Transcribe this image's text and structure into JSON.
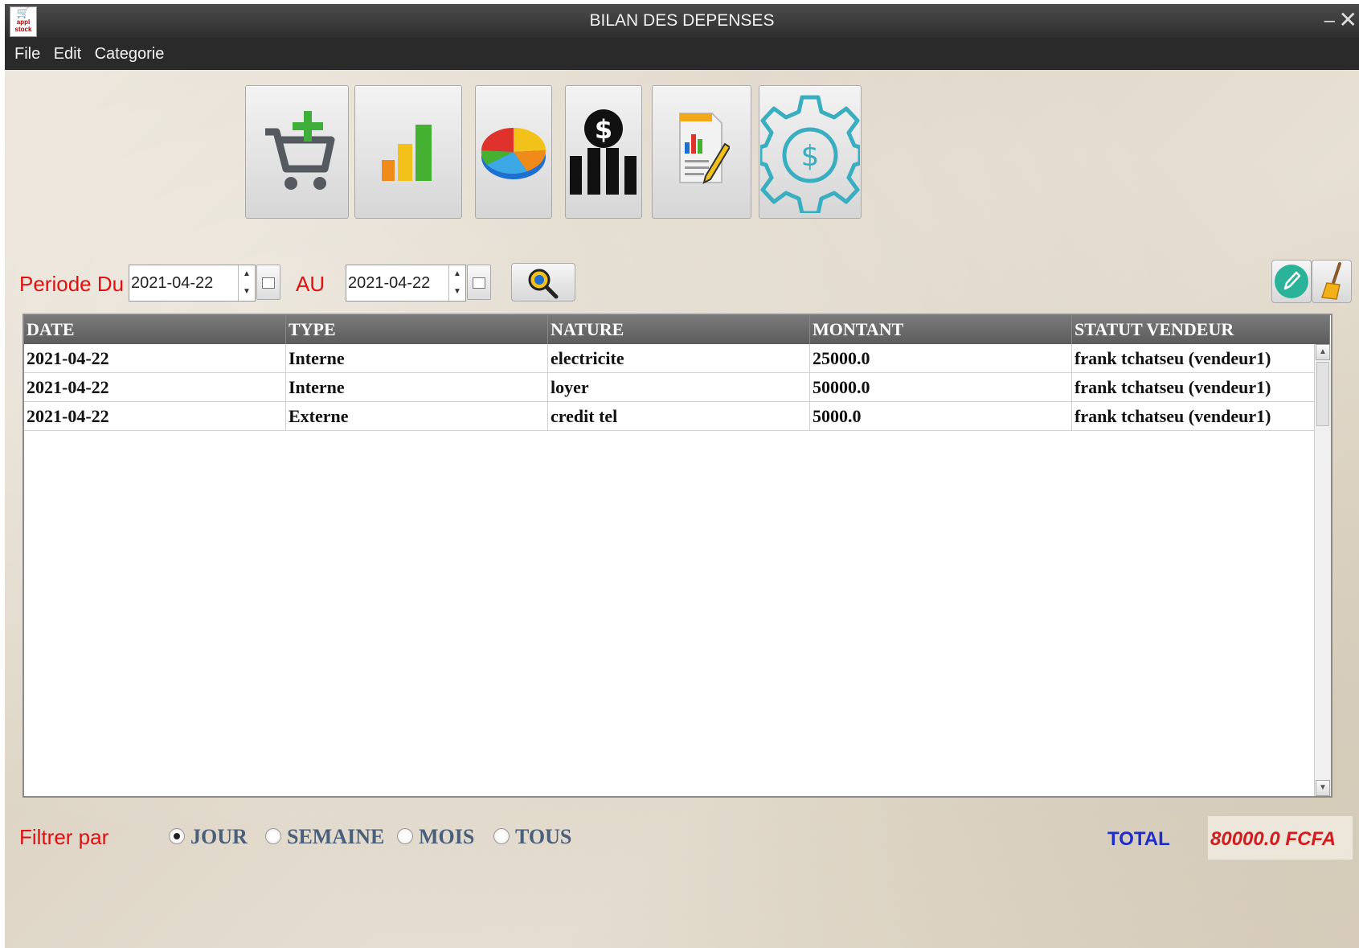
{
  "window": {
    "title": "BILAN DES DEPENSES",
    "logo_text": "appl stock",
    "minimize": "–",
    "close": "✕"
  },
  "menu": [
    "File",
    "Edit",
    "Categorie"
  ],
  "toolbar": {
    "icons": [
      "add-to-cart-icon",
      "bar-chart-icon",
      "pie-chart-icon",
      "dollar-stats-icon",
      "report-edit-icon",
      "dollar-gear-icon"
    ]
  },
  "period": {
    "from_label": "Periode Du",
    "from_value": "2021-04-22",
    "to_label": "AU",
    "to_value": "2021-04-22"
  },
  "table": {
    "headers": [
      "DATE",
      "TYPE",
      "NATURE",
      "MONTANT",
      "STATUT VENDEUR"
    ],
    "rows": [
      [
        "2021-04-22",
        "Interne",
        "electricite",
        "25000.0",
        "frank tchatseu (vendeur1)"
      ],
      [
        "2021-04-22",
        "Interne",
        "loyer",
        "50000.0",
        "frank tchatseu (vendeur1)"
      ],
      [
        "2021-04-22",
        "Externe",
        "credit tel",
        "5000.0",
        "frank tchatseu (vendeur1)"
      ]
    ]
  },
  "filter": {
    "label": "Filtrer par",
    "options": [
      "JOUR",
      "SEMAINE",
      "MOIS",
      "TOUS"
    ],
    "selected": "JOUR"
  },
  "total": {
    "label": "TOTAL",
    "value": "80000.0 FCFA"
  },
  "colors": {
    "label_red": "#e01010",
    "total_blue": "#1e2cc8",
    "total_value_red": "#d31c1c",
    "header_gray": "#6a6a6a"
  }
}
